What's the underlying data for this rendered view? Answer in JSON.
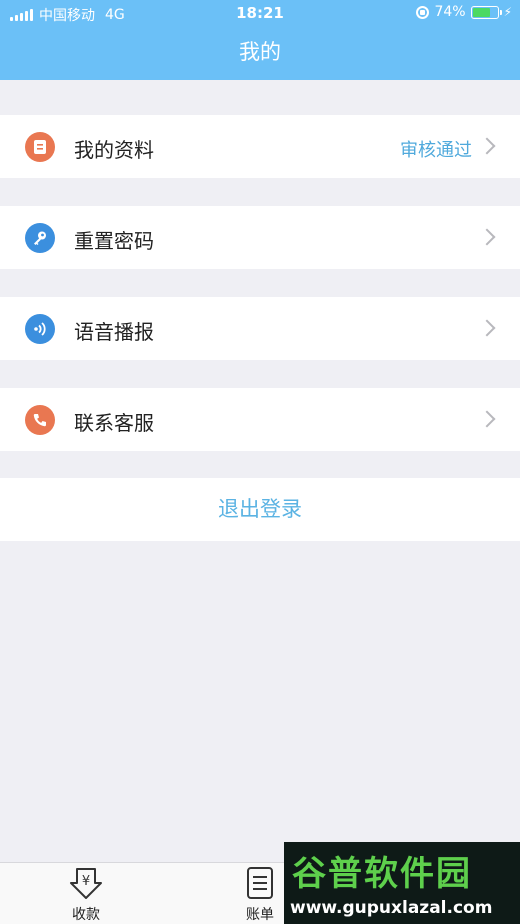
{
  "status_bar": {
    "carrier": "中国移动",
    "network": "4G",
    "time": "18:21",
    "battery": "74%",
    "battery_level": 0.74,
    "accent_battery": "#4cd964"
  },
  "header": {
    "title": "我的",
    "color": "#6bc0f7"
  },
  "menu": [
    {
      "label": "我的资料",
      "status": "审核通过",
      "icon": "document-icon",
      "icon_color": "#e97751"
    },
    {
      "label": "重置密码",
      "status": "",
      "icon": "key-icon",
      "icon_color": "#3b8fde"
    },
    {
      "label": "语音播报",
      "status": "",
      "icon": "sound-wave-icon",
      "icon_color": "#3b8fde"
    },
    {
      "label": "联系客服",
      "status": "",
      "icon": "phone-icon",
      "icon_color": "#e97751"
    }
  ],
  "logout_label": "退出登录",
  "tabbar": {
    "tabs": [
      {
        "label": "收款",
        "icon": "yen-download-icon"
      },
      {
        "label": "账单",
        "icon": "bill-icon"
      }
    ]
  },
  "watermark": {
    "text": "谷普软件园",
    "url": "www.gupuxlazal.com"
  }
}
